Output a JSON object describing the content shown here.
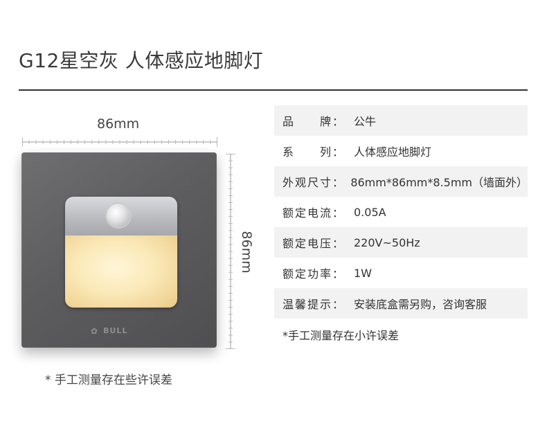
{
  "header": {
    "title": "G12星空灰  人体感应地脚灯"
  },
  "product": {
    "width_label": "86mm",
    "height_label": "86mm",
    "brand_mark": "BULL",
    "note": "* 手工测量存在些许误差"
  },
  "specs": {
    "rows": [
      {
        "label": "品　　牌：",
        "value": "公牛"
      },
      {
        "label": "系　　列：",
        "value": "人体感应地脚灯"
      },
      {
        "label": "外观尺寸：",
        "value": "86mm*86mm*8.5mm（墙面外）"
      },
      {
        "label": "额定电流：",
        "value": "0.05A"
      },
      {
        "label": "额定电压：",
        "value": "220V~50Hz"
      },
      {
        "label": "额定功率：",
        "value": "1W"
      },
      {
        "label": "温馨提示：",
        "value": "安装底盒需另购，咨询客服"
      }
    ],
    "note": "*手工测量存在小许误差"
  },
  "colors": {
    "panel": "#5d5d60",
    "glow": "#fbe9b8",
    "row_shade": "#f2f2f2",
    "divider": "#333333"
  }
}
